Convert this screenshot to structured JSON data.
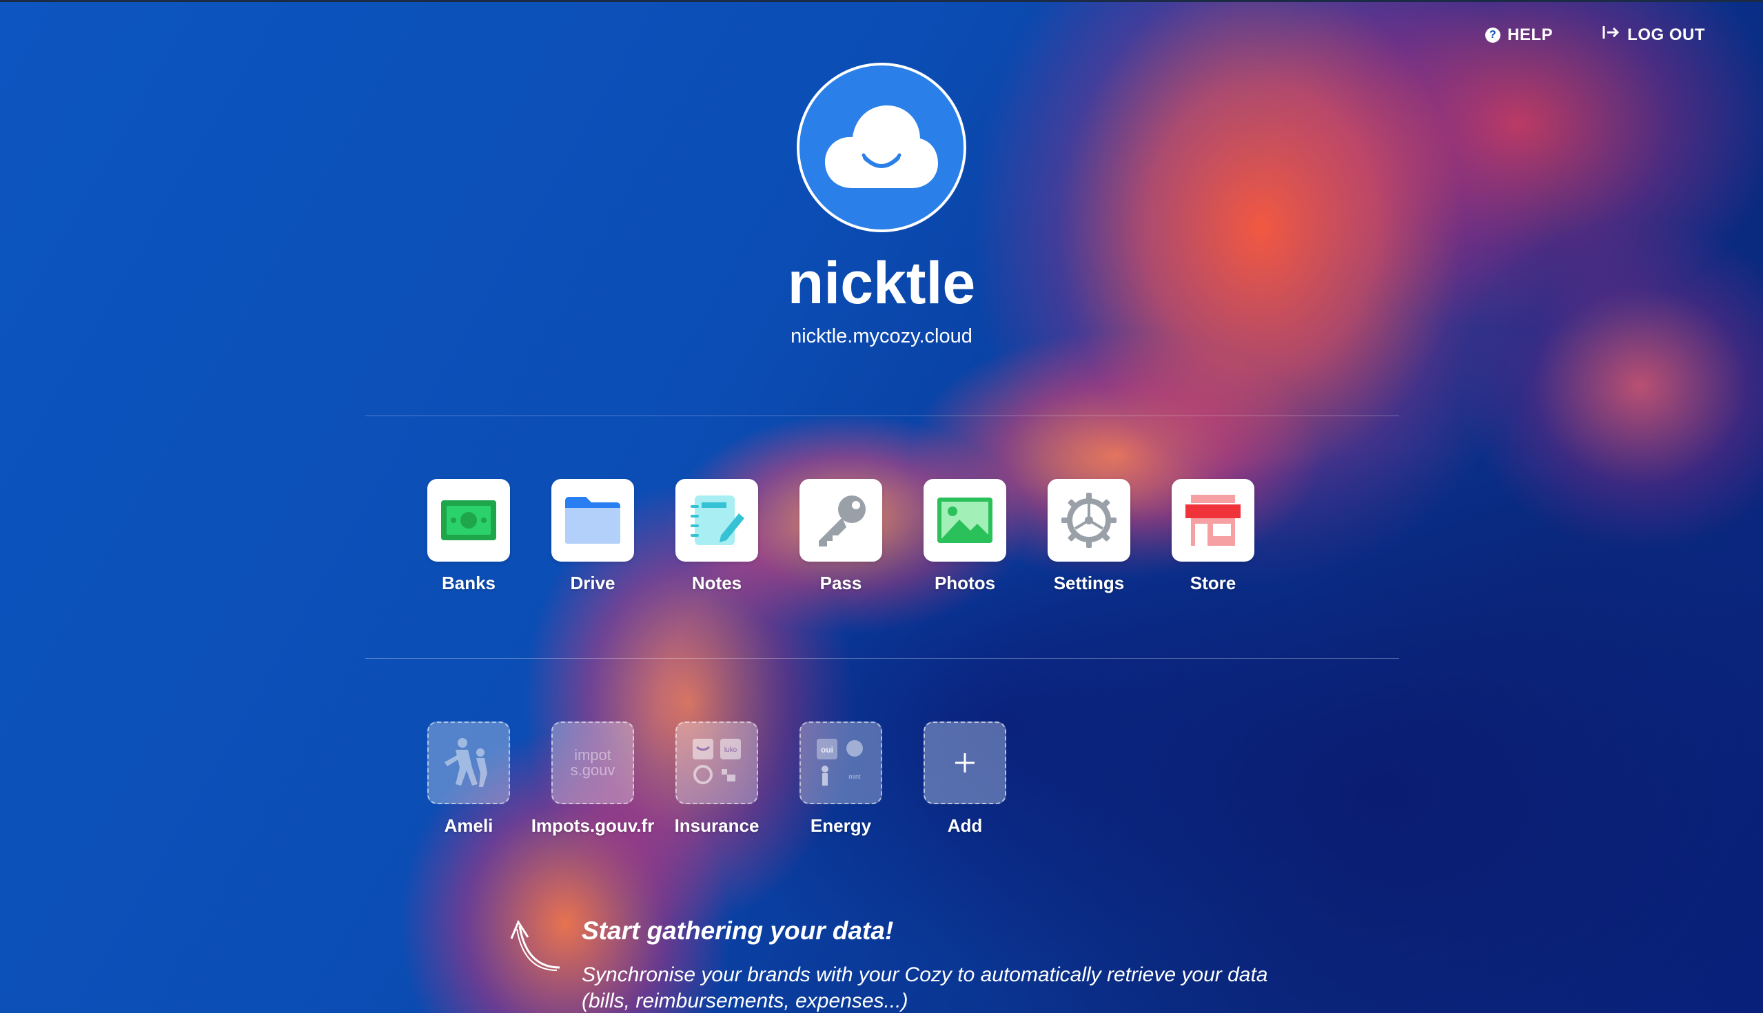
{
  "nav": {
    "help_label": "HELP",
    "help_icon": "help-circle-icon",
    "logout_label": "LOG OUT",
    "logout_icon": "logout-icon"
  },
  "profile": {
    "avatar_icon": "cozy-cloud-icon",
    "username": "nicktle",
    "domain": "nicktle.mycozy.cloud"
  },
  "apps": [
    {
      "label": "Banks",
      "icon": "banks-icon",
      "color": "#1fa64a"
    },
    {
      "label": "Drive",
      "icon": "drive-folder-icon",
      "color": "#297ef2"
    },
    {
      "label": "Notes",
      "icon": "notes-icon",
      "color": "#35c2d4"
    },
    {
      "label": "Pass",
      "icon": "key-icon",
      "color": "#9aa0a8"
    },
    {
      "label": "Photos",
      "icon": "photos-icon",
      "color": "#2ac05a"
    },
    {
      "label": "Settings",
      "icon": "settings-gear-icon",
      "color": "#9aa0a8"
    },
    {
      "label": "Store",
      "icon": "store-icon",
      "color": "#f0323a"
    }
  ],
  "suggestions": [
    {
      "label": "Ameli",
      "icon": "ameli-icon"
    },
    {
      "label": "Impots.gouv.fr",
      "icon": "impots-gouv-icon",
      "logo_text": "impots.gouv"
    },
    {
      "label": "Insurance",
      "icon": "insurance-icon"
    },
    {
      "label": "Energy",
      "icon": "energy-icon"
    },
    {
      "label": "Add",
      "icon": "plus-icon"
    }
  ],
  "gather": {
    "title": "Start gathering your data!",
    "text": "Synchronise your brands with your Cozy to automatically retrieve your data (bills, reimbursements, expenses...)"
  }
}
